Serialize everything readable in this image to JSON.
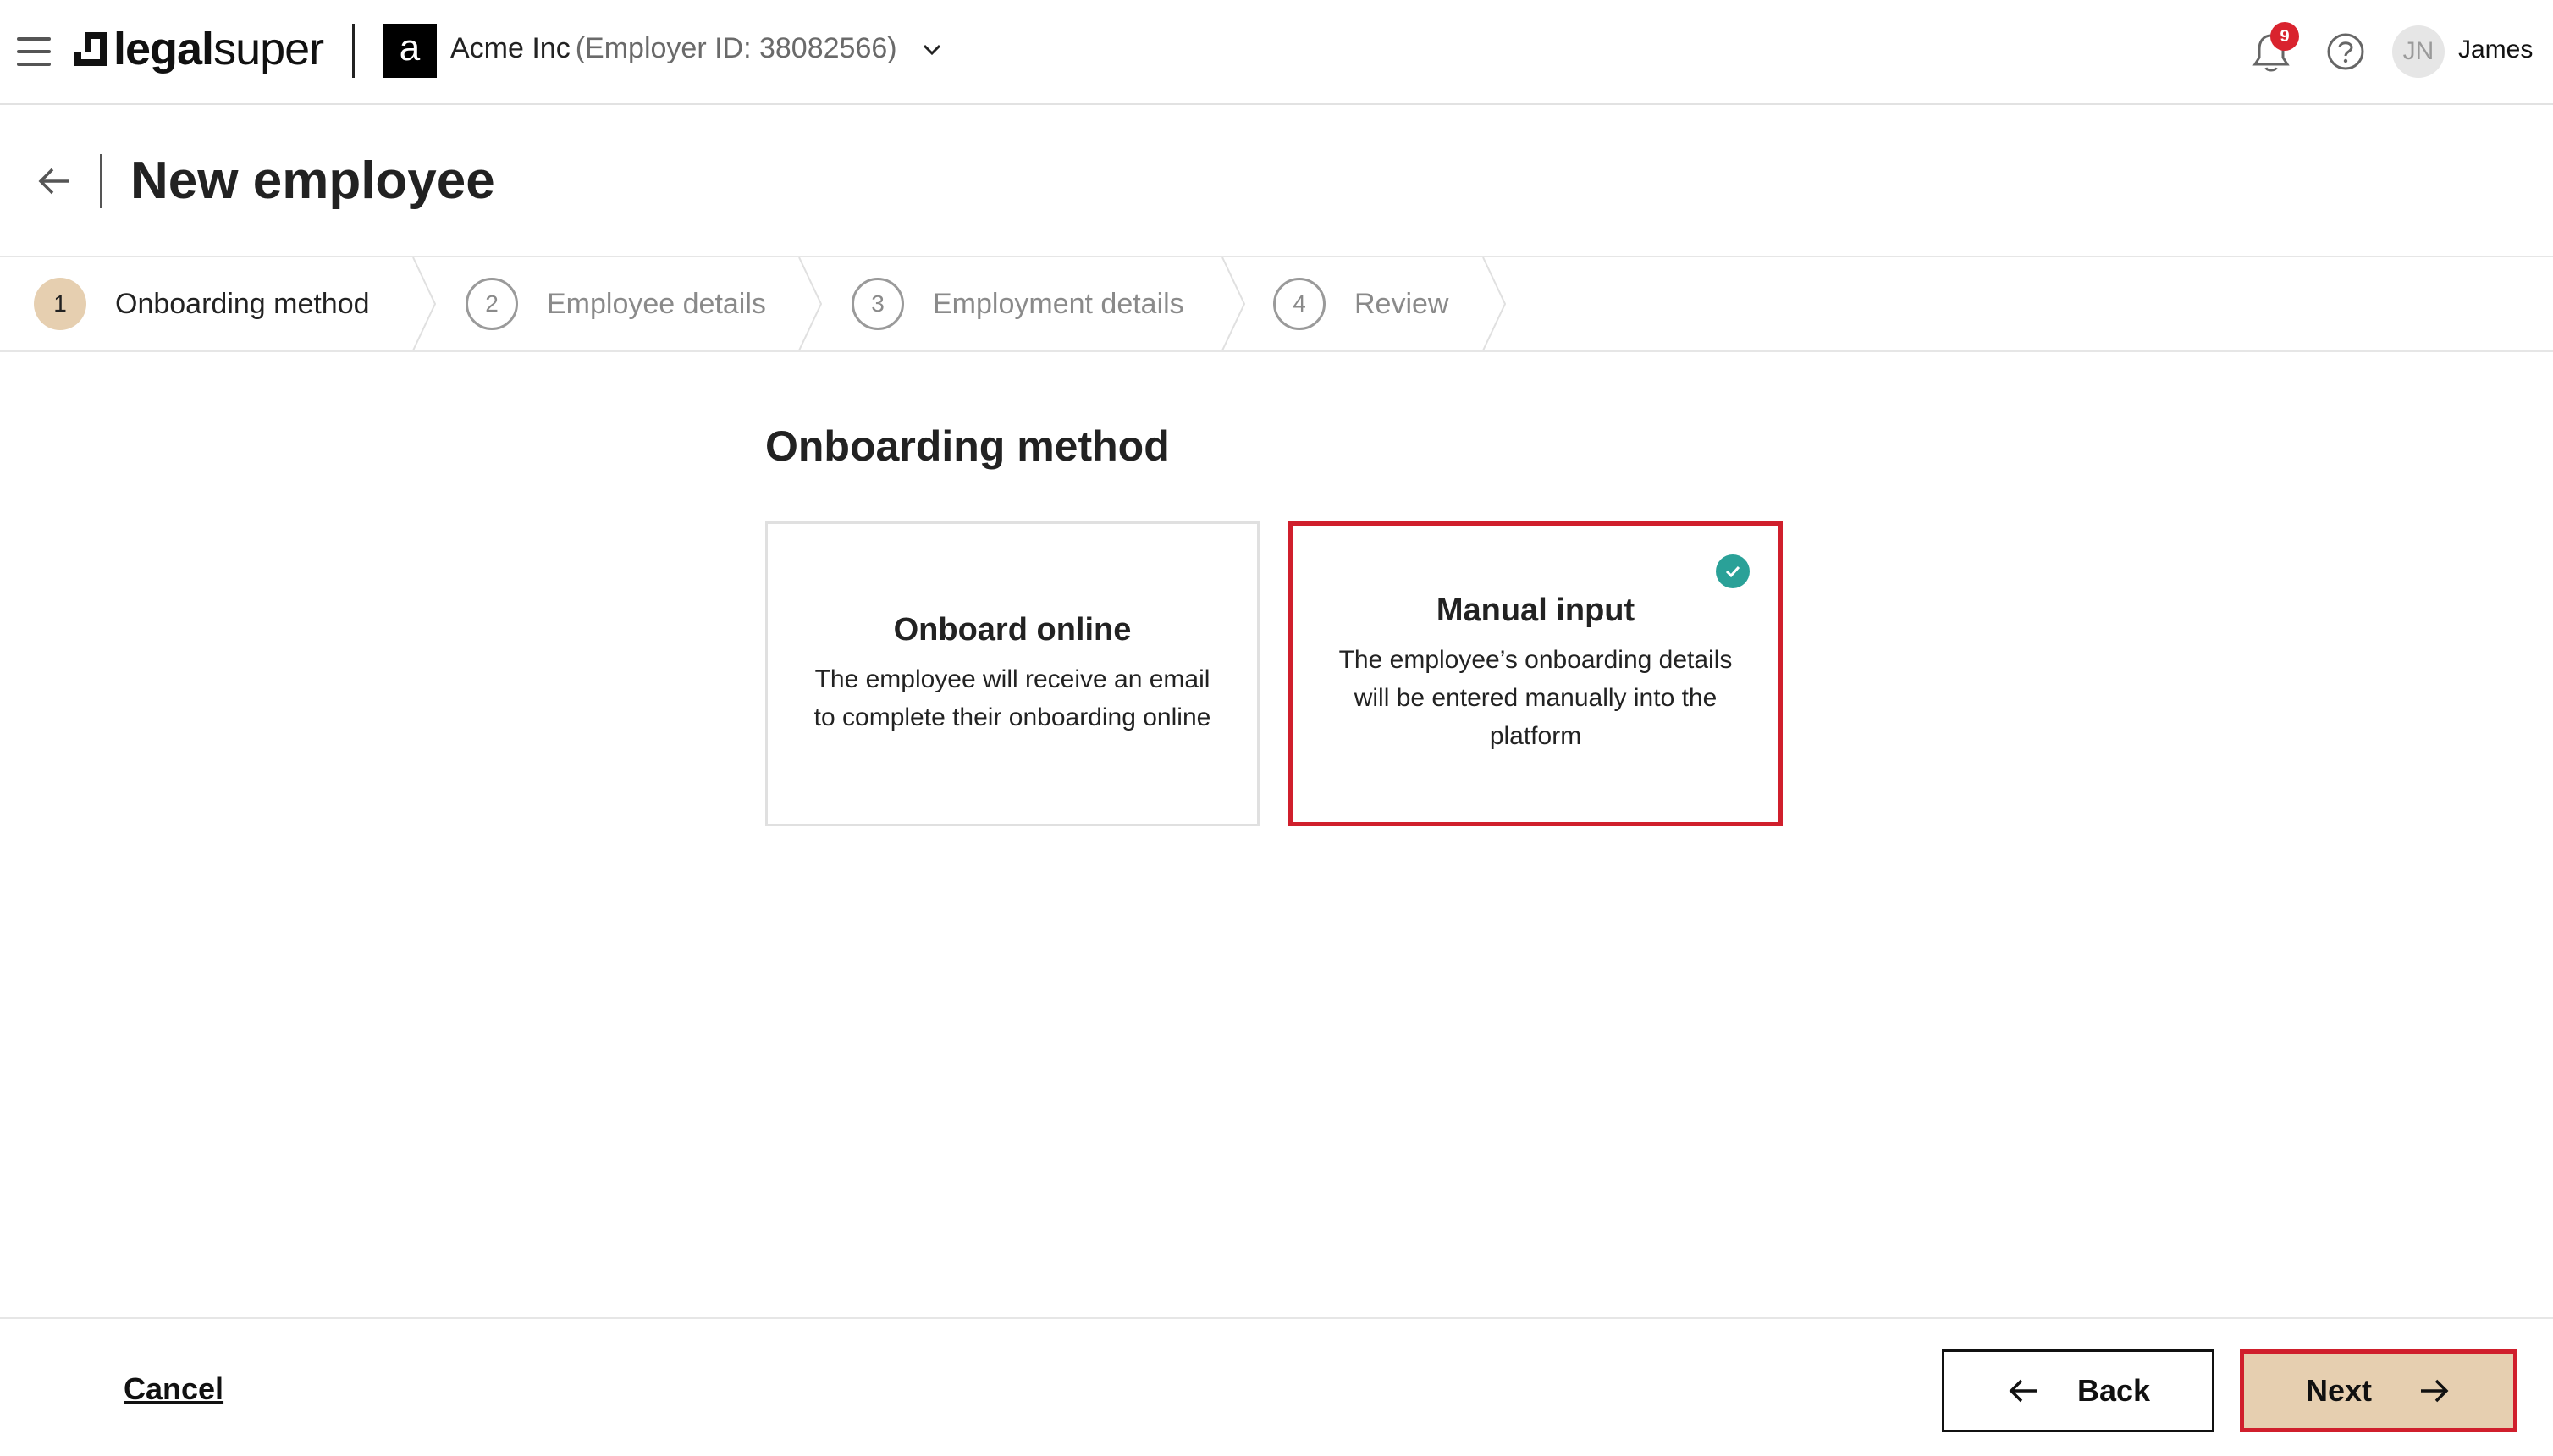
{
  "header": {
    "menu_icon": "hamburger-icon",
    "brand": {
      "bold": "legal",
      "light": "super"
    },
    "org_logo_letter": "a",
    "org_name": "Acme Inc",
    "org_id_text": "(Employer ID: 38082566)",
    "notifications_count": "9",
    "user_initials": "JN",
    "user_name": "James"
  },
  "page": {
    "title": "New employee"
  },
  "stepper": {
    "steps": [
      {
        "num": "1",
        "label": "Onboarding method",
        "state": "active"
      },
      {
        "num": "2",
        "label": "Employee details",
        "state": "inactive"
      },
      {
        "num": "3",
        "label": "Employment details",
        "state": "inactive"
      },
      {
        "num": "4",
        "label": "Review",
        "state": "inactive"
      }
    ]
  },
  "section": {
    "title": "Onboarding method",
    "options": [
      {
        "title": "Onboard online",
        "description": "The employee will receive an email to complete their onboarding online",
        "selected": false
      },
      {
        "title": "Manual input",
        "description": "The employee’s onboarding details will be entered manually into the platform",
        "selected": true
      }
    ]
  },
  "footer": {
    "cancel_label": "Cancel",
    "back_label": "Back",
    "next_label": "Next"
  },
  "colors": {
    "accent": "#e6cfb0",
    "highlight_border": "#d01f2c",
    "check": "#2aa198",
    "badge": "#d9232e"
  }
}
